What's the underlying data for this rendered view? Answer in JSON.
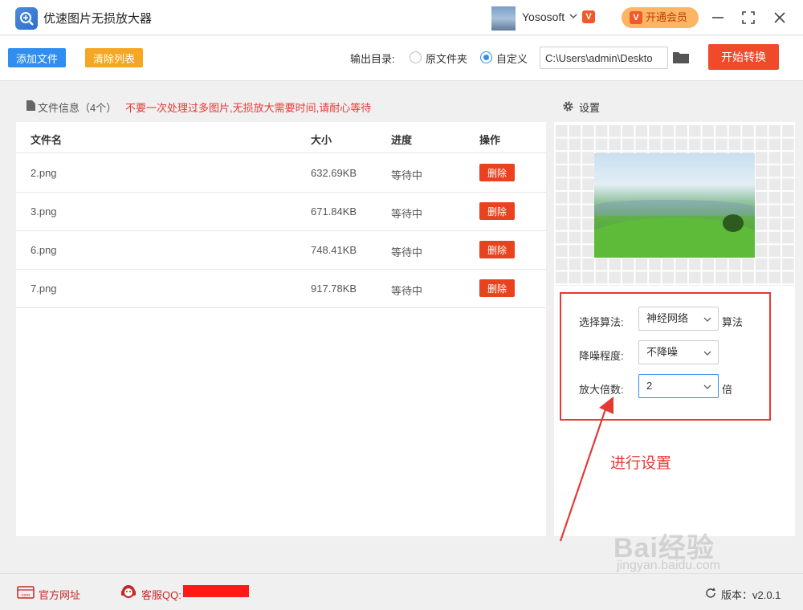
{
  "app": {
    "title": "优速图片无损放大器"
  },
  "user": {
    "name": "Yososoft",
    "vip_badge": "V"
  },
  "vip": {
    "label": "开通会员"
  },
  "toolbar": {
    "add_files": "添加文件",
    "clear_list": "清除列表",
    "output_dir_label": "输出目录:",
    "option_original": "原文件夹",
    "option_custom": "自定义",
    "output_path": "C:\\Users\\admin\\Deskto",
    "start": "开始转换"
  },
  "files": {
    "header_title": "文件信息（4个）",
    "warning": "不要一次处理过多图片,无损放大需要时间,请耐心等待",
    "columns": {
      "name": "文件名",
      "size": "大小",
      "progress": "进度",
      "action": "操作"
    },
    "rows": [
      {
        "name": "2.png",
        "size": "632.69KB",
        "progress": "等待中",
        "action": "删除"
      },
      {
        "name": "3.png",
        "size": "671.84KB",
        "progress": "等待中",
        "action": "删除"
      },
      {
        "name": "6.png",
        "size": "748.41KB",
        "progress": "等待中",
        "action": "删除"
      },
      {
        "name": "7.png",
        "size": "917.78KB",
        "progress": "等待中",
        "action": "删除"
      }
    ]
  },
  "settings": {
    "title": "设置",
    "algorithm_label": "选择算法:",
    "algorithm_value": "神经网络",
    "algorithm_unit": "算法",
    "denoise_label": "降噪程度:",
    "denoise_value": "不降噪",
    "scale_label": "放大倍数:",
    "scale_value": "2",
    "scale_unit": "倍"
  },
  "annotation": "进行设置",
  "footer": {
    "website": "官方网址",
    "qq": "客服QQ:",
    "version": "版本：v2.0.1"
  },
  "watermark": {
    "main": "Bai经验",
    "sub": "jingyan.baidu.com"
  },
  "colors": {
    "primary": "#2f8ef0",
    "danger": "#e8421e",
    "accent": "#f5a623",
    "start": "#f04a2a"
  }
}
